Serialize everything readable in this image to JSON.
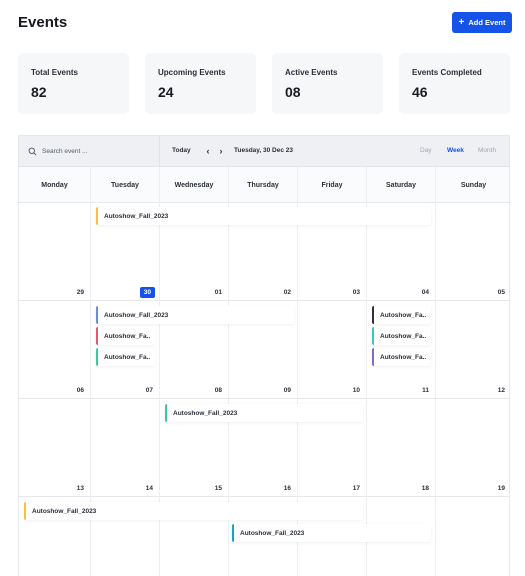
{
  "header": {
    "title": "Events",
    "add_button_label": "Add Event"
  },
  "stats": [
    {
      "label": "Total Events",
      "value": "82"
    },
    {
      "label": "Upcoming Events",
      "value": "24"
    },
    {
      "label": "Active Events",
      "value": "08"
    },
    {
      "label": "Events Completed",
      "value": "46"
    }
  ],
  "toolbar": {
    "search_placeholder": "Search event ...",
    "today_label": "Today",
    "prev_arrow": "‹",
    "next_arrow": "›",
    "current_date": "Tuesday, 30 Dec 23",
    "views": [
      "Day",
      "Week",
      "Month"
    ],
    "active_view": "Week"
  },
  "day_headers": [
    "Monday",
    "Tuesday",
    "Wednesday",
    "Thursday",
    "Friday",
    "Saturday",
    "Sunday"
  ],
  "weeks": [
    {
      "days": [
        "29",
        "30",
        "01",
        "02",
        "03",
        "04",
        "05"
      ],
      "today_index": 1
    },
    {
      "days": [
        "06",
        "07",
        "08",
        "09",
        "10",
        "11",
        "12"
      ]
    },
    {
      "days": [
        "13",
        "14",
        "15",
        "16",
        "17",
        "18",
        "19"
      ]
    },
    {
      "days": [
        "",
        "",
        "",
        "",
        "",
        "",
        ""
      ]
    }
  ],
  "events": {
    "w1_e1": {
      "title": "Autoshow_Fall_2023",
      "color": "#f5c04a"
    },
    "w2_e1": {
      "title": "Autoshow_Fall_2023",
      "color": "#6b8fd6"
    },
    "w2_e2": {
      "title": "Autoshow_Fa..",
      "color": "#e05a6b"
    },
    "w2_e3": {
      "title": "Autoshow_Fa..",
      "color": "#3cc99a"
    },
    "w2_e4": {
      "title": "Autoshow_Fa..",
      "color": "#2d2f3a"
    },
    "w2_e5": {
      "title": "Autoshow_Fa..",
      "color": "#3cc9b4"
    },
    "w2_e6": {
      "title": "Autoshow_Fa..",
      "color": "#7a6bd6"
    },
    "w3_e1": {
      "title": "Autoshow_Fall_2023",
      "color": "#3cc99a"
    },
    "w4_e1": {
      "title": "Autoshow_Fall_2023",
      "color": "#f5c04a"
    },
    "w4_e2": {
      "title": "Autoshow_Fall_2023",
      "color": "#1aa3c9"
    }
  },
  "icons": {
    "search": "search-icon",
    "plus": "plus-icon",
    "prev": "chevron-left-icon",
    "next": "chevron-right-icon"
  },
  "colors": {
    "accent": "#1553e8"
  }
}
